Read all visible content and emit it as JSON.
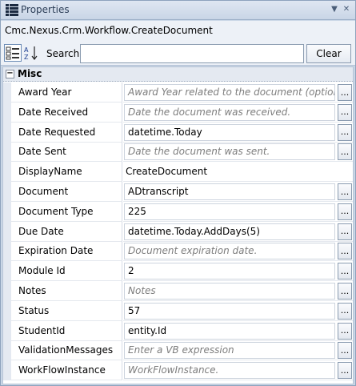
{
  "window": {
    "title": "Properties"
  },
  "object_type": "Cmc.Nexus.Crm.Workflow.CreateDocument",
  "toolbar": {
    "search_label": "Search:",
    "search_value": "",
    "clear_label": "Clear"
  },
  "category": {
    "toggle": "−",
    "label": "Misc"
  },
  "properties": [
    {
      "name": "Award Year",
      "value": "Award Year related to the document (optional).",
      "placeholder": true,
      "editor": "box"
    },
    {
      "name": "Date Received",
      "value": "Date the document was received.",
      "placeholder": true,
      "editor": "box"
    },
    {
      "name": "Date Requested",
      "value": "datetime.Today",
      "placeholder": false,
      "editor": "box"
    },
    {
      "name": "Date Sent",
      "value": "Date the document was sent.",
      "placeholder": true,
      "editor": "box"
    },
    {
      "name": "DisplayName",
      "value": "CreateDocument",
      "placeholder": false,
      "editor": "plain"
    },
    {
      "name": "Document",
      "value": "ADtranscript",
      "placeholder": false,
      "editor": "box"
    },
    {
      "name": "Document Type",
      "value": "225",
      "placeholder": false,
      "editor": "box"
    },
    {
      "name": "Due Date",
      "value": "datetime.Today.AddDays(5)",
      "placeholder": false,
      "editor": "box"
    },
    {
      "name": "Expiration Date",
      "value": "Document expiration date.",
      "placeholder": true,
      "editor": "box"
    },
    {
      "name": "Module Id",
      "value": "2",
      "placeholder": false,
      "editor": "box"
    },
    {
      "name": "Notes",
      "value": "Notes",
      "placeholder": true,
      "editor": "box"
    },
    {
      "name": "Status",
      "value": "57",
      "placeholder": false,
      "editor": "box"
    },
    {
      "name": "StudentId",
      "value": "entity.Id",
      "placeholder": false,
      "editor": "box"
    },
    {
      "name": "ValidationMessages",
      "value": "Enter a VB expression",
      "placeholder": true,
      "editor": "box"
    },
    {
      "name": "WorkFlowInstance",
      "value": "WorkFlowInstance.",
      "placeholder": true,
      "editor": "box"
    }
  ],
  "ellipsis_label": "...",
  "colors": {
    "panel_bg": "#c9d6e6",
    "category_bg": "#e4e9f1",
    "placeholder_text": "#7d7d7d"
  }
}
